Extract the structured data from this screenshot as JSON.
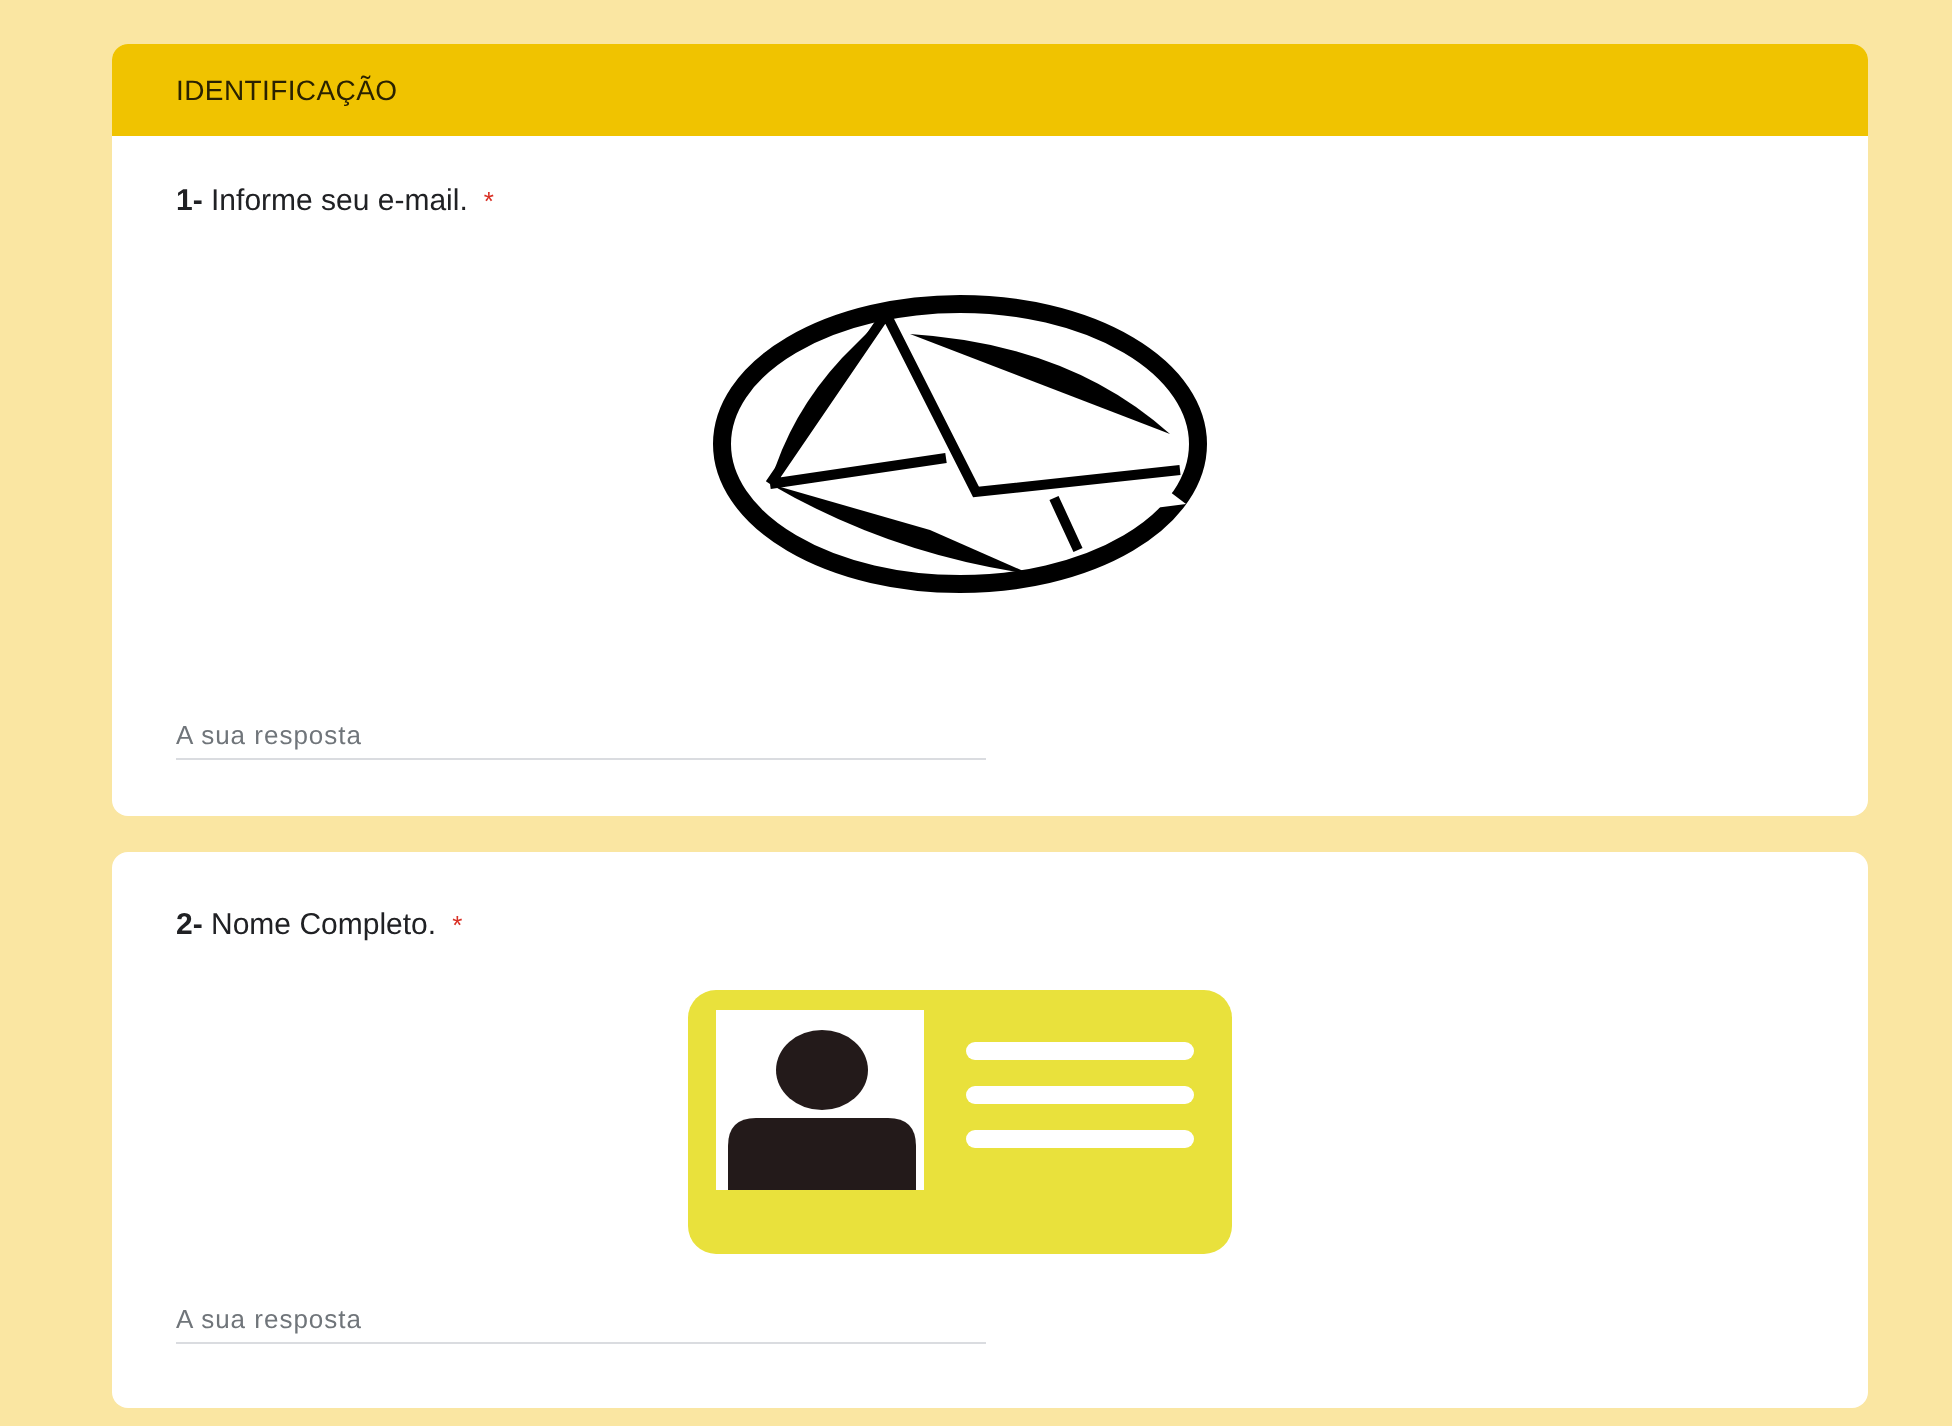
{
  "section": {
    "title": "IDENTIFICAÇÃO"
  },
  "questions": [
    {
      "text": "**1-** Informe seu e-mail.",
      "required_mark": "*",
      "kind": "email",
      "placeholder": "A sua resposta"
    },
    {
      "text": "**2-** Nome Completo.",
      "required_mark": "*",
      "kind": "id-card",
      "placeholder": "A sua resposta"
    }
  ]
}
